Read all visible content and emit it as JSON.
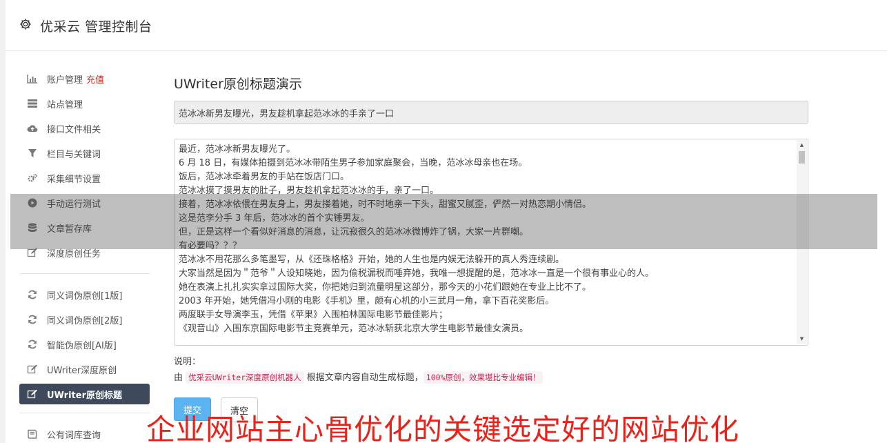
{
  "header": {
    "title": "优采云 管理控制台"
  },
  "sidebar": {
    "group1": [
      {
        "label": "账户管理",
        "badge": "充值",
        "icon": "bar-chart-icon"
      },
      {
        "label": "站点管理",
        "icon": "server-icon"
      },
      {
        "label": "接口文件相关",
        "icon": "cloud-upload-icon"
      },
      {
        "label": "栏目与关键词",
        "icon": "filter-icon"
      },
      {
        "label": "采集细节设置",
        "icon": "cogs-icon"
      },
      {
        "label": "手动运行测试",
        "icon": "play-icon"
      },
      {
        "label": "文章暂存库",
        "icon": "database-icon"
      },
      {
        "label": "深度原创任务",
        "icon": "edit-icon"
      }
    ],
    "group2": [
      {
        "label": "同义词伪原创[1版]",
        "icon": "refresh-icon"
      },
      {
        "label": "同义词伪原创[2版]",
        "icon": "refresh-icon"
      },
      {
        "label": "智能伪原创[AI版]",
        "icon": "refresh-icon"
      },
      {
        "label": "UWriter深度原创",
        "icon": "edit-icon"
      },
      {
        "label": "UWriter原创标题",
        "icon": "edit-icon",
        "active": true
      }
    ],
    "group3": [
      {
        "label": "公有词库查询",
        "icon": "book-icon"
      }
    ]
  },
  "main": {
    "heading": "UWriter原创标题演示",
    "title_value": "范冰冰新男友曝光，男友趁机拿起范冰冰的手亲了一口",
    "content_lines": [
      "最近，范冰冰新男友曝光了。",
      "6 月 18 日，有媒体拍摄到范冰冰带陌生男子参加家庭聚会，当晚，范冰冰母亲也在场。",
      "饭后，范冰冰牵着男友的手站在饭店门口。",
      "范冰冰摸了摸男友的肚子，男友趁机拿起范冰冰的手，亲了一口。",
      "接着，范冰冰依偎在男友身上，男友搂着她，时不时地亲一下头，甜蜜又腻歪，俨然一对热恋期小情侣。",
      "这是范李分手 3 年后，范冰冰的首个实锤男友。",
      "但，正是这样一个看似好消息的消息，让沉寂很久的范冰冰微博炸了锅，大家一片群嘲。",
      "有必要吗？？？",
      "范冰冰不用花那么多笔墨写，从《还珠格格》开始，她的人生也是内娱无法躲开的真人秀连续剧。",
      "大家当然是因为＂范爷＂人设知晓她，因为偷税漏税而唾弃她，我唯一想提醒的是，范冰冰一直是一个很有事业心的人。",
      "她在表演上扎扎实实拿过国际大奖，你把她归到流量明星这部分，那今天的小花们跟她在专业上比不了。",
      "2003 年开始，她凭借冯小刚的电影《手机》里，颇有心机的小三武月一角，拿下百花奖影后。",
      "两度联手女导演李玉，凭借《苹果》入围柏林国际电影节最佳影片；",
      "《观音山》入围东京国际电影节主竞赛单元，范冰冰斩获北京大学生电影节最佳女演员。"
    ],
    "desc_label": "说明：",
    "desc_prefix": "由",
    "desc_link": "优采云UWriter深度原创机器人",
    "desc_middle": "根据文章内容自动生成标题，",
    "desc_code": "100%原创，效果堪比专业编辑！",
    "submit_label": "提交",
    "clear_label": "清空"
  },
  "watermark": "企业网站主心骨优化的关键选定好的网站优化"
}
